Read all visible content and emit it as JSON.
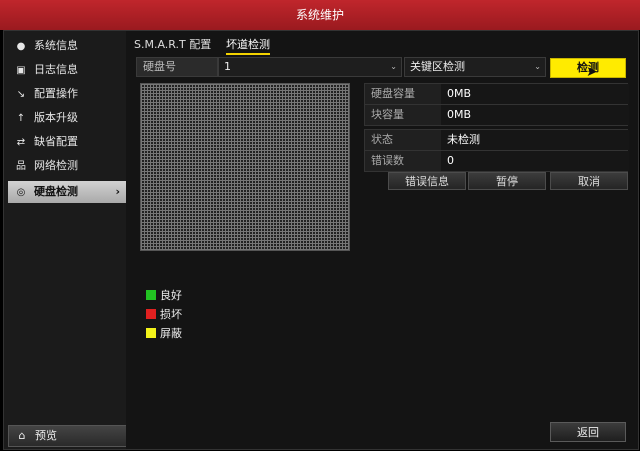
{
  "window": {
    "title": "系统维护"
  },
  "sidebar": {
    "items": [
      {
        "label": "系统信息",
        "icon": "info-icon"
      },
      {
        "label": "日志信息",
        "icon": "log-icon"
      },
      {
        "label": "配置操作",
        "icon": "config-icon"
      },
      {
        "label": "版本升级",
        "icon": "upgrade-icon"
      },
      {
        "label": "缺省配置",
        "icon": "default-icon"
      },
      {
        "label": "网络检测",
        "icon": "network-icon"
      },
      {
        "label": "硬盘检测",
        "icon": "disk-check-icon",
        "active": true
      }
    ],
    "preview_label": "预览"
  },
  "tabs": [
    {
      "label": "S.M.A.R.T 配置"
    },
    {
      "label": "坏道检测",
      "active": true
    }
  ],
  "disk": {
    "label": "硬盘号",
    "value": "1",
    "mode_value": "关键区检测",
    "detect_button": "检测"
  },
  "info": {
    "capacity_label": "硬盘容量",
    "capacity_value": "0MB",
    "block_label": "块容量",
    "block_value": "0MB",
    "status_label": "状态",
    "status_value": "未检测",
    "errors_label": "错误数",
    "errors_value": "0"
  },
  "actions": {
    "error_info": "错误信息",
    "pause": "暂停",
    "cancel": "取消"
  },
  "legend": [
    {
      "label": "良好",
      "color": "#22c322"
    },
    {
      "label": "损坏",
      "color": "#e02020"
    },
    {
      "label": "屏蔽",
      "color": "#f2f21a"
    }
  ],
  "footer": {
    "back_label": "返回"
  },
  "colors": {
    "title_bar": "#b2202a",
    "highlight": "#ffeb00"
  }
}
